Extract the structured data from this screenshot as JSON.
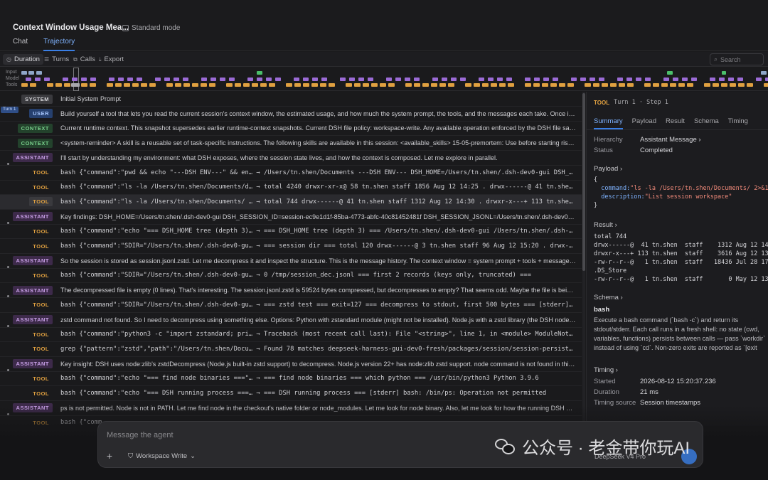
{
  "header": {
    "title": "Context Window Usage Mea...",
    "mode": "Standard mode",
    "tabs": [
      {
        "label": "Chat"
      },
      {
        "label": "Trajectory"
      }
    ]
  },
  "toolbar": {
    "duration": "Duration",
    "turns": "Turns",
    "calls": "Calls",
    "export": "Export",
    "search_placeholder": "Search"
  },
  "timeline": {
    "labels": [
      "Input",
      "Model",
      "Tools"
    ],
    "colors": {
      "input": "#8fa6c8",
      "model": "#9b6bd6",
      "tools": "#e0a040",
      "accent": "#4bbf6b"
    }
  },
  "rows": [
    {
      "role": "SYSTEM",
      "text": "Initial System Prompt"
    },
    {
      "role": "USER",
      "turn": "Turn 1",
      "text": "Build yourself a tool that lets you read the current session's context window, the estimated usage, and how much the system prompt, the tools, and the messages each take. Once it's ..."
    },
    {
      "role": "CONTEXT",
      "text": "Current runtime context. This snapshot supersedes earlier runtime-context snapshots. Current DSH file policy: workspace-write. Any available operation enforced by the DSH file sand..."
    },
    {
      "role": "CONTEXT",
      "text": "<system-reminder> A skill is a reusable set of task-specific instructions. The following skills are available in this session: <available_skills> 15-05-premortem: Use before starting risky ..."
    },
    {
      "role": "ASSISTANT",
      "text": "I'll start by understanding my environment: what DSH exposes, where the session state lives, and how the context is composed. Let me explore in parallel."
    },
    {
      "role": "TOOL",
      "text": "bash {\"command\":\"pwd && echo \"---DSH ENV---\" && en…  → /Users/tn.shen/Documents ---DSH ENV--- DSH_HOME=/Users/tn.shen/.dsh-dev0-gui DSH_SESSION_..."
    },
    {
      "role": "TOOL",
      "text": "bash {\"command\":\"ls -la /Users/tn.shen/Documents/d…  → total 4240 drwxr-xr-x@ 58 tn.shen staff 1856 Aug 12 14:25 . drwx------@ 41 tn.shen staff ..."
    },
    {
      "role": "TOOL",
      "selected": true,
      "text": "bash {\"command\":\"ls -la /Users/tn.shen/Documents/ …  → total 744 drwx------@ 41 tn.shen staff 1312 Aug 12 14:30 . drwxr-x---+ 113 tn.shen staff ..."
    },
    {
      "role": "ASSISTANT",
      "text": "Key findings: DSH_HOME=/Users/tn.shen/.dsh-dev0-gui DSH_SESSION_ID=session-ec9e1d1f-85ba-4773-abfc-40c81452481f DSH_SESSION_JSONL=/Users/tn.shen/.dsh-dev0-gui/s..."
    },
    {
      "role": "TOOL",
      "text": "bash {\"command\":\"echo \"=== DSH_HOME tree (depth 3)…  → === DSH_HOME tree (depth 3) === /Users/tn.shen/.dsh-dev0-gui /Users/tn.shen/.dsh-dev0-g..."
    },
    {
      "role": "TOOL",
      "text": "bash {\"command\":\"SDIR=\"/Users/tn.shen/.dsh-dev0-gu…  → === session dir === total 120 drwx------@ 3 tn.shen staff 96 Aug 12 15:20 . drwx------@ ..."
    },
    {
      "role": "ASSISTANT",
      "text": "So the session is stored as session.jsonl.zstd. Let me decompress it and inspect the structure. This is the message history. The context window = system prompt + tools + messages. L..."
    },
    {
      "role": "TOOL",
      "text": "bash {\"command\":\"SDIR=\"/Users/tn.shen/.dsh-dev0-gu…  → 0 /tmp/session_dec.jsonl === first 2 records (keys only, truncated) ==="
    },
    {
      "role": "ASSISTANT",
      "text": "The decompressed file is empty (0 lines). That's interesting. The session.jsonl.zstd is 59524 bytes compressed, but decompresses to empty? That seems odd. Maybe the file is being a..."
    },
    {
      "role": "TOOL",
      "text": "bash {\"command\":\"SDIR=\"/Users/tn.shen/.dsh-dev0-gu…  → === zstd test === exit=127 === decompress to stdout, first 500 bytes === [stderr] bash: z..."
    },
    {
      "role": "ASSISTANT",
      "text": "zstd command not found. So I need to decompress using something else. Options: Python with zstandard module (might not be installed). Node.js with a zstd library (the DSH node_m..."
    },
    {
      "role": "TOOL",
      "text": "bash {\"command\":\"python3 -c \"import zstandard; pri…  → Traceback (most recent call last): File \"<string>\", line 1, in <module> ModuleNotFoundErr..."
    },
    {
      "role": "TOOL",
      "text": "grep {\"pattern\":\"zstd\",\"path\":\"/Users/tn.shen/Docu…  → Found 78 matches deepseek-harness-gui-dev0-fresh/packages/session/session-persistence-jso..."
    },
    {
      "role": "ASSISTANT",
      "text": "Key insight: DSH uses node:zlib's zstdDecompress (Node.js built-in zstd support) to decompress. Node.js version 22+ has node:zlib zstd support. node command is not found in this s..."
    },
    {
      "role": "TOOL",
      "text": "bash {\"command\":\"echo \"=== find node binaries ===\"…  → === find node binaries === which python === /usr/bin/python3 Python 3.9.6"
    },
    {
      "role": "TOOL",
      "text": "bash {\"command\":\"echo \"=== DSH running process ===…  → === DSH running process === [stderr] bash: /bin/ps: Operation not permitted"
    },
    {
      "role": "ASSISTANT",
      "text": "ps is not permitted. Node is not in PATH. Let me find node in the checkout's native folder or node_modules. Let me look for node binary. Also, let me look for how the running DSH was ..."
    },
    {
      "role": "TOOL",
      "text": "bash {\"comm..."
    }
  ],
  "detail": {
    "tool": "TOOL",
    "step": "Turn 1 · Step 1",
    "tabs": [
      {
        "label": "Summary"
      },
      {
        "label": "Payload"
      },
      {
        "label": "Result"
      },
      {
        "label": "Schema"
      },
      {
        "label": "Timing"
      }
    ],
    "hierarchy_label": "Hierarchy",
    "hierarchy_value": "Assistant Message ›",
    "status_label": "Status",
    "status_value": "Completed",
    "payload_title": "Payload ›",
    "payload_open": "{",
    "payload_cmd_key": "command:",
    "payload_cmd_val": "\"ls -la /Users/tn.shen/Documents/ 2>&1",
    "payload_desc_key": "description:",
    "payload_desc_val": "\"List session workspace\"",
    "payload_close": "}",
    "result_title": "Result ›",
    "result_lines": [
      "total 744",
      "drwx------@  41 tn.shen  staff    1312 Aug 12 14:3",
      "drwxr-x---+ 113 tn.shen  staff    3616 Aug 12 13:5",
      "-rw-r--r--@   1 tn.shen  staff   18436 Jul 28 17:4",
      ".DS_Store",
      "-rw-r--r--@   1 tn.shen  staff       0 May 12 13:5"
    ],
    "schema_title": "Schema ›",
    "schema_name": "bash",
    "schema_desc": "Execute a bash command (`bash -c`) and return its stdout/stderr. Each call runs in a fresh shell: no state (cwd, variables, functions) persists between calls — pass `workdir` instead of using `cd`. Non-zero exits are reported as `[exit",
    "timing_title": "Timing ›",
    "started_label": "Started",
    "started_value": "2026-08-12 15:20:37.236",
    "duration_label": "Duration",
    "duration_value": "21 ms",
    "source_label": "Timing source",
    "source_value": "Session timestamps"
  },
  "composer": {
    "placeholder": "Message the agent",
    "workspace": "Workspace Write",
    "model": "DeepSeek V4 Pro"
  },
  "watermark": {
    "text": "公众号 · 老金带你玩AI"
  }
}
